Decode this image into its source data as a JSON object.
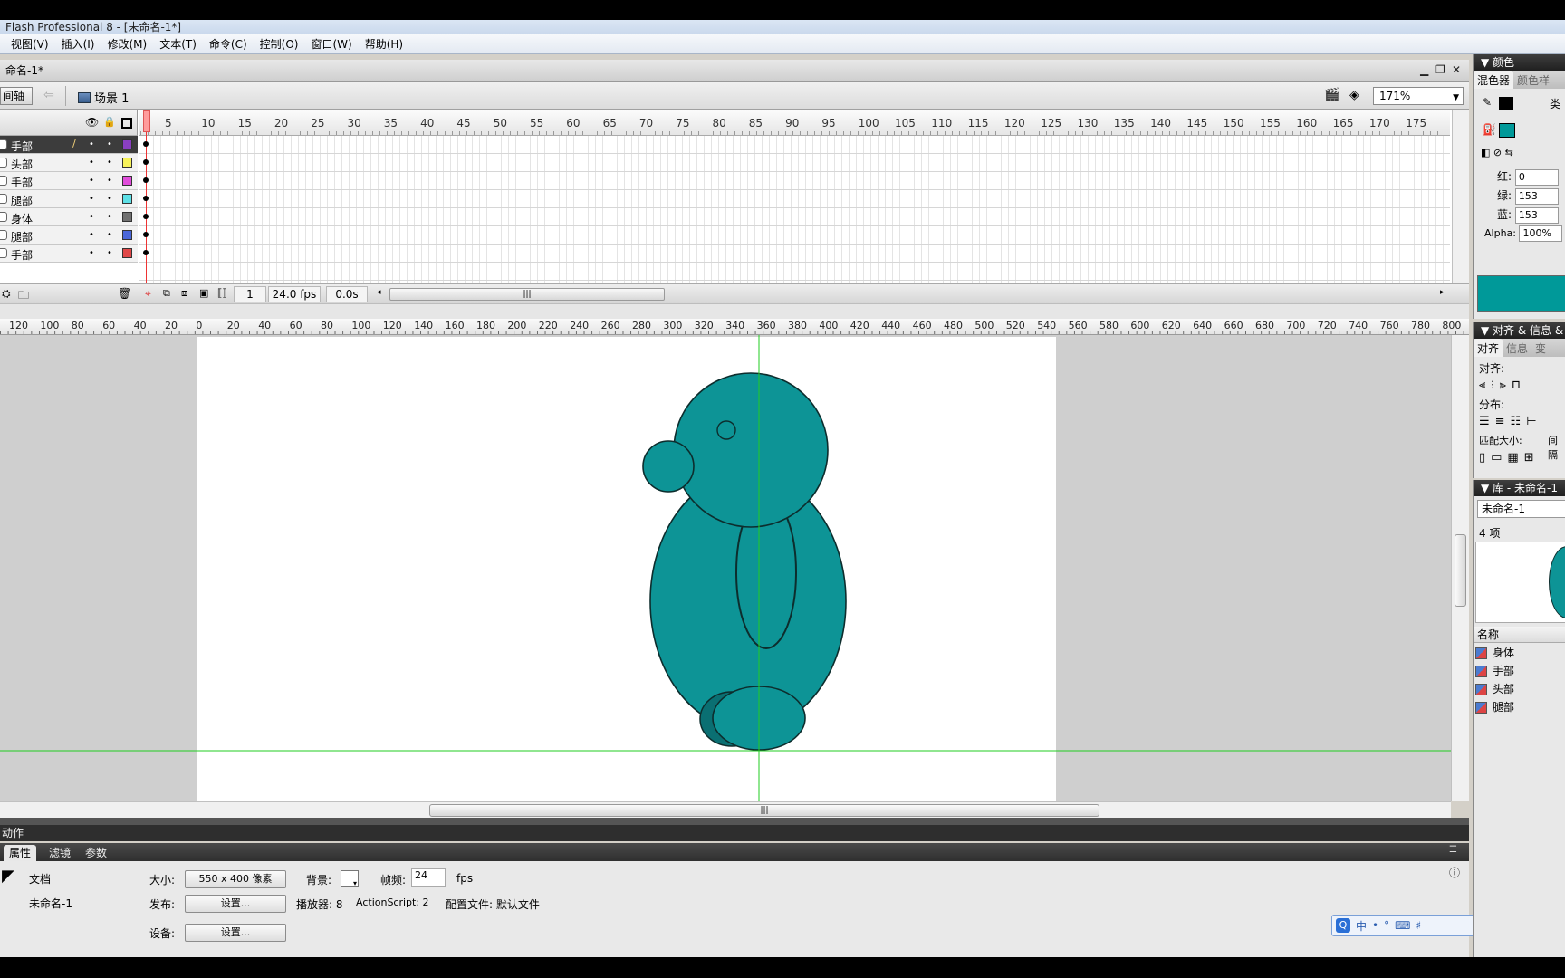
{
  "window": {
    "title": "Flash Professional 8 - [未命名-1*]"
  },
  "menu": [
    "视图(V)",
    "插入(I)",
    "修改(M)",
    "文本(T)",
    "命令(C)",
    "控制(O)",
    "窗口(W)",
    "帮助(H)"
  ],
  "doc_tab": "命名-1*",
  "editbar": {
    "timeline_button": "间轴",
    "scene": "场景 1",
    "zoom": "171%"
  },
  "timeline": {
    "frame_ticks": [
      "5",
      "10",
      "15",
      "20",
      "25",
      "30",
      "35",
      "40",
      "45",
      "50",
      "55",
      "60",
      "65",
      "70",
      "75",
      "80",
      "85",
      "90",
      "95",
      "100",
      "105",
      "110",
      "115",
      "120",
      "125",
      "130",
      "135",
      "140",
      "145",
      "150",
      "155",
      "160",
      "165",
      "170",
      "175"
    ],
    "layers": [
      {
        "name": "手部",
        "color": "#8a3fc0",
        "active": true
      },
      {
        "name": "头部",
        "color": "#f7f25a",
        "active": false
      },
      {
        "name": "手部",
        "color": "#e14ddb",
        "active": false
      },
      {
        "name": "腿部",
        "color": "#5de0e6",
        "active": false
      },
      {
        "name": "身体",
        "color": "#707070",
        "active": false
      },
      {
        "name": "腿部",
        "color": "#4a66d8",
        "active": false
      },
      {
        "name": "手部",
        "color": "#e04848",
        "active": false
      }
    ],
    "current_frame": "1",
    "fps": "24.0 fps",
    "elapsed": "0.0s"
  },
  "stage_ruler": [
    "120",
    "100",
    "80",
    "60",
    "40",
    "20",
    "0",
    "20",
    "40",
    "60",
    "80",
    "100",
    "120",
    "140",
    "160",
    "180",
    "200",
    "220",
    "240",
    "260",
    "280",
    "300",
    "320",
    "340",
    "360",
    "380",
    "400",
    "420",
    "440",
    "460",
    "480",
    "500",
    "520",
    "540",
    "560",
    "580",
    "600",
    "620",
    "640",
    "660",
    "680",
    "700",
    "720",
    "740",
    "760",
    "780",
    "800"
  ],
  "stage": {
    "fill_color": "#0d9496",
    "shadow_color": "#0a6f72",
    "stroke_color": "#0d2d2d",
    "guide_color": "#22cc22"
  },
  "actions": {
    "label": "动作"
  },
  "properties": {
    "tabs": [
      "属性",
      "滤镜",
      "参数"
    ],
    "doc_label": "文档",
    "doc_name": "未命名-1",
    "size_label": "大小:",
    "size_value": "550 x 400 像素",
    "bg_label": "背景:",
    "fps_label": "帧频:",
    "fps_value": "24",
    "fps_unit": "fps",
    "publish_label": "发布:",
    "publish_button": "设置...",
    "player_label": "播放器: 8",
    "as_label": "ActionScript: 2",
    "profile_label": "配置文件: 默认文件",
    "device_label": "设备:",
    "device_button": "设置..."
  },
  "ime": {
    "chars": [
      "中",
      "•",
      "°",
      "⌨",
      "♯"
    ]
  },
  "color_panel": {
    "header": "颜色",
    "tabs": [
      "混色器",
      "颜色样"
    ],
    "type_label": "类",
    "red_label": "红:",
    "red": "0",
    "green_label": "绿:",
    "green": "153",
    "blue_label": "蓝:",
    "blue": "153",
    "alpha_label": "Alpha:",
    "alpha": "100%",
    "swatch": "#009999"
  },
  "align_panel": {
    "header": "对齐 & 信息 &",
    "tabs": [
      "对齐",
      "信息",
      "变"
    ],
    "align_label": "对齐:",
    "distribute_label": "分布:",
    "match_label": "匹配大小:",
    "spacing_label": "间隔"
  },
  "library_panel": {
    "header": "库 - 未命名-1",
    "doc": "未命名-1",
    "count": "4 项",
    "name_header": "名称",
    "items": [
      "身体",
      "手部",
      "头部",
      "腿部"
    ]
  }
}
